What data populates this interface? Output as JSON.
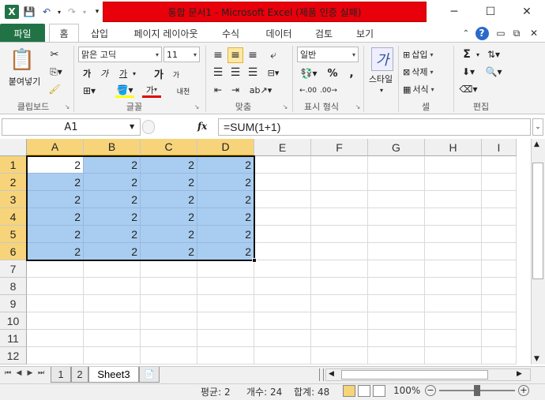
{
  "window": {
    "title": "통합 문서1  -  Microsoft Excel (제품 인증 실패)",
    "controls": {
      "minimize": "─",
      "restore": "☐",
      "close": "✕"
    }
  },
  "qat": {
    "excel_icon": "excel-logo-icon",
    "save": "save-icon",
    "undo": "undo-icon",
    "redo": "redo-icon"
  },
  "tabs": {
    "file": "파일",
    "items": [
      "홈",
      "삽입",
      "페이지 레이아웃",
      "수식",
      "데이터",
      "검토",
      "보기"
    ],
    "active": "홈"
  },
  "ribbon": {
    "clipboard": {
      "label": "클립보드",
      "paste": "붙여넣기"
    },
    "font": {
      "label": "글꼴",
      "font_name": "맑은 고딕",
      "font_size": "11",
      "bold": "가",
      "italic": "가",
      "underline": "가",
      "grow": "가",
      "shrink": "가",
      "color_a": "가",
      "phonetic": "내천"
    },
    "alignment": {
      "label": "맞춤"
    },
    "number": {
      "label": "표시 형식",
      "format": "일반",
      "percent": "%",
      "comma": ","
    },
    "styles": {
      "label": "스타일"
    },
    "cells": {
      "label": "셀",
      "insert": "삽입",
      "delete": "삭제",
      "format": "서식"
    },
    "editing": {
      "label": "편집",
      "sum": "Σ"
    }
  },
  "formula_bar": {
    "name_box": "A1",
    "fx": "fx",
    "formula": "=SUM(1+1)"
  },
  "grid": {
    "columns": [
      "A",
      "B",
      "C",
      "D",
      "E",
      "F",
      "G",
      "H",
      "I"
    ],
    "rows": [
      "1",
      "2",
      "3",
      "4",
      "5",
      "6",
      "7",
      "8",
      "9",
      "10",
      "11",
      "12"
    ],
    "selected_columns": [
      "A",
      "B",
      "C",
      "D"
    ],
    "selected_rows": [
      "1",
      "2",
      "3",
      "4",
      "5",
      "6"
    ],
    "values": [
      [
        "2",
        "2",
        "2",
        "2"
      ],
      [
        "2",
        "2",
        "2",
        "2"
      ],
      [
        "2",
        "2",
        "2",
        "2"
      ],
      [
        "2",
        "2",
        "2",
        "2"
      ],
      [
        "2",
        "2",
        "2",
        "2"
      ],
      [
        "2",
        "2",
        "2",
        "2"
      ]
    ]
  },
  "sheets": {
    "tabs": [
      "1",
      "2",
      "Sheet3"
    ],
    "active": "Sheet3"
  },
  "status": {
    "average": "평균: 2",
    "count": "개수: 24",
    "sum": "합계: 48",
    "zoom": "100%"
  },
  "colors": {
    "file_tab": "#217346",
    "title_red": "#e8000b",
    "selection": "#a9cdf0",
    "header_highlight": "#f7d47a"
  }
}
